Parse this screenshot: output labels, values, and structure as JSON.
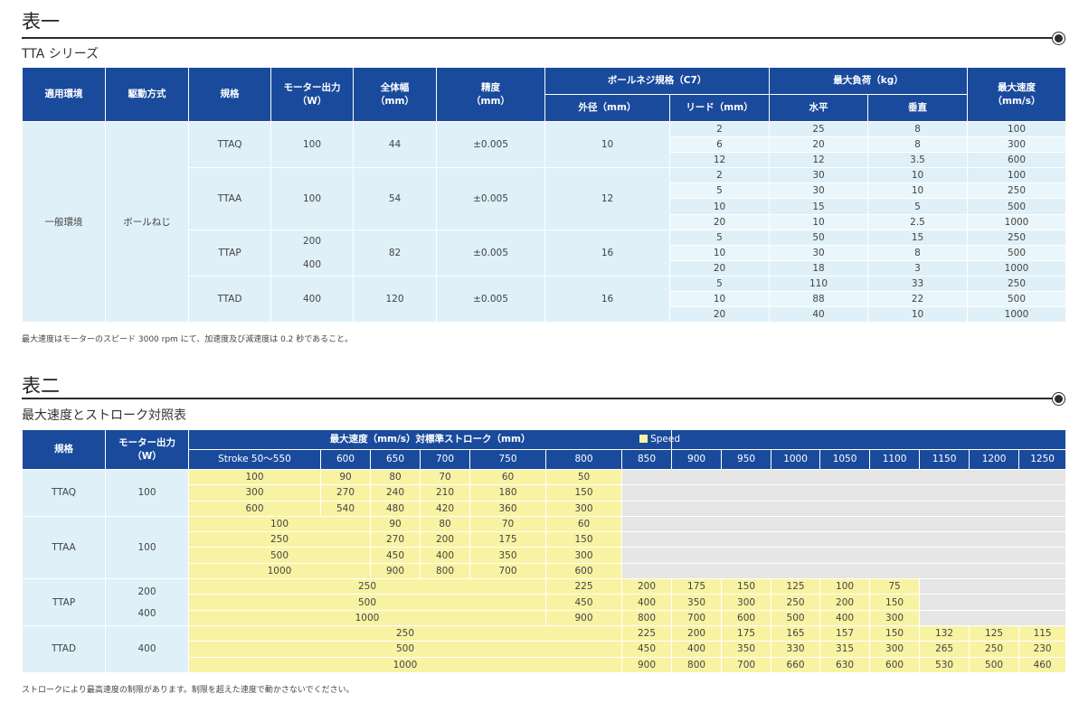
{
  "section1": {
    "title": "表一",
    "subtitle": "TTA シリーズ",
    "note": "最大速度はモーターのスピード 3000 rpm にて、加速度及び減速度は 0.2 秒であること。"
  },
  "section2": {
    "title": "表二",
    "subtitle": "最大速度とストローク対照表",
    "note": "ストロークにより最高速度の制限があります。制限を超えた速度で動かさないでください。"
  },
  "table1": {
    "headers": {
      "env": "適用環境",
      "drive": "駆動方式",
      "model": "規格",
      "motor": "モーター出力",
      "motor_unit": "（W）",
      "width": "全体幅",
      "width_unit": "（mm）",
      "accuracy": "精度",
      "accuracy_unit": "（mm）",
      "ballscrew": "ボールネジ規格（C7）",
      "outer": "外径（mm）",
      "lead": "リード（mm）",
      "load": "最大負荷（kg）",
      "horizontal": "水平",
      "vertical": "垂直",
      "speed": "最大速度",
      "speed_unit": "（mm/s）"
    },
    "env": "一般環境",
    "drive": "ボールねじ",
    "groups": [
      {
        "model": "TTAQ",
        "motor": [
          "100"
        ],
        "width": "44",
        "accuracy": "±0.005",
        "outer": "10",
        "rows": [
          [
            "2",
            "25",
            "8",
            "100"
          ],
          [
            "6",
            "20",
            "8",
            "300"
          ],
          [
            "12",
            "12",
            "3.5",
            "600"
          ]
        ]
      },
      {
        "model": "TTAA",
        "motor": [
          "100"
        ],
        "width": "54",
        "accuracy": "±0.005",
        "outer": "12",
        "rows": [
          [
            "2",
            "30",
            "10",
            "100"
          ],
          [
            "5",
            "30",
            "10",
            "250"
          ],
          [
            "10",
            "15",
            "5",
            "500"
          ],
          [
            "20",
            "10",
            "2.5",
            "1000"
          ]
        ]
      },
      {
        "model": "TTAP",
        "motor": [
          "200",
          "400"
        ],
        "width": "82",
        "accuracy": "±0.005",
        "outer": "16",
        "rows": [
          [
            "5",
            "50",
            "15",
            "250"
          ],
          [
            "10",
            "30",
            "8",
            "500"
          ],
          [
            "20",
            "18",
            "3",
            "1000"
          ]
        ]
      },
      {
        "model": "TTAD",
        "motor": [
          "400"
        ],
        "width": "120",
        "accuracy": "±0.005",
        "outer": "16",
        "rows": [
          [
            "5",
            "110",
            "33",
            "250"
          ],
          [
            "10",
            "88",
            "22",
            "500"
          ],
          [
            "20",
            "40",
            "10",
            "1000"
          ]
        ]
      }
    ]
  },
  "table2": {
    "headers": {
      "model": "規格",
      "motor": "モーター出力",
      "motor_unit": "（W）",
      "main": "最大速度（mm/s）対標準ストローク（mm）",
      "legend": "Speed",
      "strokes": [
        "Stroke 50～550",
        "600",
        "650",
        "700",
        "750",
        "800",
        "850",
        "900",
        "950",
        "1000",
        "1050",
        "1100",
        "1150",
        "1200",
        "1250"
      ]
    },
    "groups": [
      {
        "model": "TTAQ",
        "motor": [
          "100"
        ],
        "rows": [
          [
            "100",
            "90",
            "80",
            "70",
            "60",
            "50"
          ],
          [
            "300",
            "270",
            "240",
            "210",
            "180",
            "150"
          ],
          [
            "600",
            "540",
            "480",
            "420",
            "360",
            "300"
          ]
        ]
      },
      {
        "model": "TTAA",
        "motor": [
          "100"
        ],
        "rows": [
          [
            "100",
            "90",
            "80",
            "70",
            "60"
          ],
          [
            "250",
            "270",
            "200",
            "175",
            "150"
          ],
          [
            "500",
            "450",
            "400",
            "350",
            "300"
          ],
          [
            "1000",
            "900",
            "800",
            "700",
            "600"
          ]
        ]
      },
      {
        "model": "TTAP",
        "motor": [
          "200",
          "400"
        ],
        "rows": [
          [
            "250",
            "225",
            "200",
            "175",
            "150",
            "125",
            "100",
            "75"
          ],
          [
            "500",
            "450",
            "400",
            "350",
            "300",
            "250",
            "200",
            "150"
          ],
          [
            "1000",
            "900",
            "800",
            "700",
            "600",
            "500",
            "400",
            "300"
          ]
        ]
      },
      {
        "model": "TTAD",
        "motor": [
          "400"
        ],
        "rows": [
          [
            "250",
            "225",
            "200",
            "175",
            "165",
            "157",
            "150",
            "132",
            "125",
            "115"
          ],
          [
            "500",
            "450",
            "400",
            "350",
            "330",
            "315",
            "300",
            "265",
            "250",
            "230"
          ],
          [
            "1000",
            "900",
            "800",
            "700",
            "660",
            "630",
            "600",
            "530",
            "500",
            "460"
          ]
        ]
      }
    ]
  }
}
